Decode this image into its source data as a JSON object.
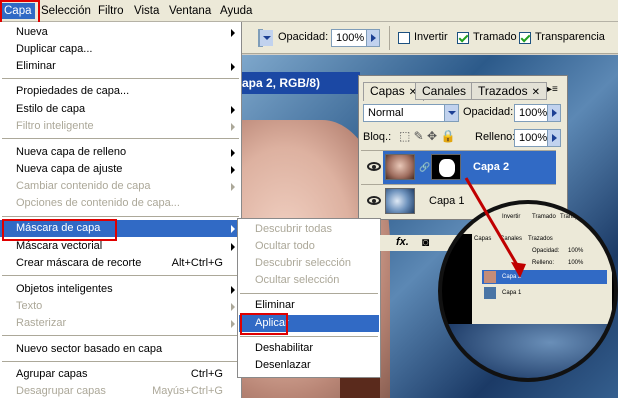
{
  "menubar": {
    "items": [
      "Capa",
      "Selección",
      "Filtro",
      "Vista",
      "Ventana",
      "Ayuda"
    ]
  },
  "options_bar": {
    "opacity_label": "Opacidad:",
    "opacity_value": "100%",
    "invertir": "Invertir",
    "tramado": "Tramado",
    "transparencia": "Transparencia"
  },
  "document": {
    "title": "apa 2, RGB/8)"
  },
  "menu": {
    "nueva": "Nueva",
    "duplicar": "Duplicar capa...",
    "eliminar": "Eliminar",
    "propiedades": "Propiedades de capa...",
    "estilo": "Estilo de capa",
    "filtro": "Filtro inteligente",
    "relleno": "Nueva capa de relleno",
    "ajuste": "Nueva capa de ajuste",
    "cambiar": "Cambiar contenido de capa",
    "opciones": "Opciones de contenido de capa...",
    "mascara_capa": "Máscara de capa",
    "mascara_vectorial": "Máscara vectorial",
    "recorte": "Crear máscara de recorte",
    "recorte_sc": "Alt+Ctrl+G",
    "objetos": "Objetos inteligentes",
    "texto": "Texto",
    "rasterizar": "Rasterizar",
    "sector": "Nuevo sector basado en capa",
    "agrupar": "Agrupar capas",
    "agrupar_sc": "Ctrl+G",
    "desagrupar": "Desagrupar capas",
    "desagrupar_sc": "Mayús+Ctrl+G"
  },
  "submenu": {
    "descubrir_todas": "Descubrir todas",
    "ocultar_todo": "Ocultar todo",
    "descubrir_sel": "Descubrir selección",
    "ocultar_sel": "Ocultar selección",
    "eliminar": "Eliminar",
    "aplicar": "Aplicar",
    "deshabilitar": "Deshabilitar",
    "desenlazar": "Desenlazar"
  },
  "layers_panel": {
    "tabs": [
      "Capas",
      "Canales",
      "Trazados"
    ],
    "blend_mode": "Normal",
    "opacity_label": "Opacidad:",
    "opacity_value": "100%",
    "lock_label": "Bloq.:",
    "fill_label": "Relleno:",
    "fill_value": "100%",
    "layers": [
      "Capa 2",
      "Capa 1"
    ],
    "fx": "fx."
  },
  "zoom": {
    "tabs": [
      "Capas",
      "Canales",
      "Trazados"
    ],
    "invertir": "Invertir",
    "tramado": "Tramado",
    "transparencia": "Transparencia",
    "opacity_label": "Opacidad:",
    "fill_label": "Relleno:",
    "value": "100%",
    "layers": [
      "Capa 2",
      "Capa 1"
    ]
  },
  "colors": {
    "highlight": "#316ac5",
    "annotation": "#e00000"
  }
}
